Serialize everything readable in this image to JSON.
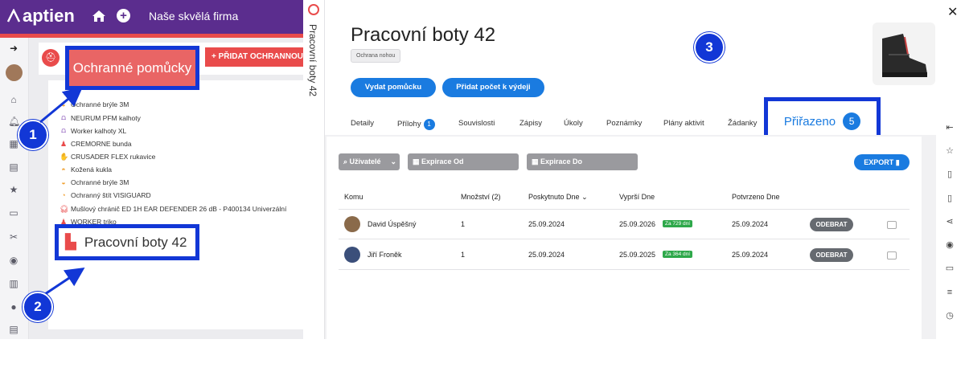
{
  "topbar": {
    "logo": "aptien",
    "company": "Naše skvělá firma"
  },
  "left": {
    "section_title": "Ochranné pomůcky",
    "add_button": "+ PŘIDAT OCHRANNOU P",
    "items": [
      {
        "label": "Ochranné brýle 3M",
        "icon": "goggles-icon",
        "color": "#f0a030"
      },
      {
        "label": "NEURUM PFM kalhoty",
        "icon": "pants-icon",
        "color": "#7a3fb0"
      },
      {
        "label": "Worker kalhoty XL",
        "icon": "pants-icon",
        "color": "#7a3fb0"
      },
      {
        "label": "CREMORNE bunda",
        "icon": "jacket-icon",
        "color": "#e94b4b"
      },
      {
        "label": "CRUSADER FLEX rukavice",
        "icon": "glove-icon",
        "color": "#e94b4b"
      },
      {
        "label": "Kožená kukla",
        "icon": "hood-icon",
        "color": "#f0a030"
      },
      {
        "label": "Ochranné brýle 3M",
        "icon": "goggles-icon",
        "color": "#f0a030"
      },
      {
        "label": "Ochranný štít VISIGUARD",
        "icon": "shield-icon",
        "color": "#f0a030"
      },
      {
        "label": "Mušlový chránič ED 1H EAR DEFENDER 26 dB - P400134 Univerzální",
        "icon": "headphones-icon",
        "color": "#e94b4b"
      },
      {
        "label": "WORKER triko",
        "icon": "shirt-icon",
        "color": "#e94b4b"
      }
    ],
    "selected_item": "Pracovní boty 42"
  },
  "callouts": {
    "one": "1",
    "two": "2",
    "three": "3"
  },
  "vertical_title": "Pracovní boty 42",
  "detail": {
    "title": "Pracovní boty 42",
    "tag": "Ochrana nohou",
    "btn_issue": "Vydat pomůcku",
    "btn_add_count": "Přidat počet k výdeji",
    "tabs": [
      {
        "label": "Detaily"
      },
      {
        "label": "Přílohy",
        "badge": "1"
      },
      {
        "label": "Souvislosti"
      },
      {
        "label": "Zápisy"
      },
      {
        "label": "Úkoly"
      },
      {
        "label": "Poznámky"
      },
      {
        "label": "Plány aktivit"
      },
      {
        "label": "Žádanky"
      }
    ],
    "active_tab": {
      "label": "Přiřazeno",
      "badge": "5"
    },
    "filters": {
      "users": "Uživatelé",
      "exp_from": "Expirace Od",
      "exp_to": "Expirace Do"
    },
    "export": "EXPORT",
    "columns": [
      "Komu",
      "Množství (2)",
      "Poskytnuto Dne",
      "Vyprší Dne",
      "Potvrzeno Dne"
    ],
    "rows": [
      {
        "name": "David Úspěšný",
        "qty": "1",
        "given": "25.09.2024",
        "expires": "25.09.2026",
        "remaining": "Za 729 dní",
        "confirmed": "25.09.2024",
        "action": "ODEBRAT"
      },
      {
        "name": "Jiří Froněk",
        "qty": "1",
        "given": "25.09.2024",
        "expires": "25.09.2025",
        "remaining": "Za 364 dní",
        "confirmed": "25.09.2024",
        "action": "ODEBRAT"
      }
    ]
  },
  "colors": {
    "brand_purple": "#5b2d8e",
    "accent_red": "#e94b4b",
    "primary_blue": "#1a7be0",
    "callout_blue": "#1237d6",
    "success_green": "#2ea84a"
  }
}
